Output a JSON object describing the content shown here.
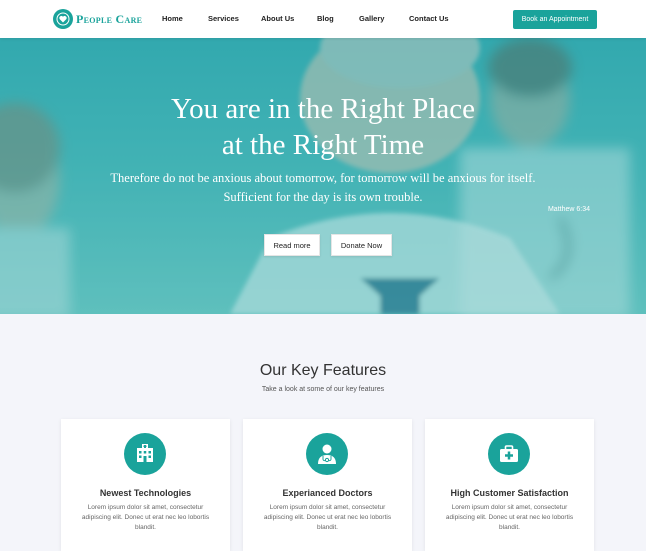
{
  "brand": {
    "name": "People Care",
    "accent": "#1aa39b"
  },
  "nav": {
    "items": [
      "Home",
      "Services",
      "About Us",
      "Blog",
      "Gallery",
      "Contact Us"
    ],
    "cta": "Book an Appointment"
  },
  "hero": {
    "title_line1": "You are in the Right Place",
    "title_line2": "at the Right Time",
    "quote_line1": "Therefore do not be anxious about tomorrow, for tomorrow will be anxious for itself.",
    "quote_line2": "Sufficient for the day is its own trouble.",
    "citation": "Matthew 6:34",
    "btn_read_more": "Read more",
    "btn_donate": "Donate Now"
  },
  "features": {
    "title": "Our Key Features",
    "subtitle": "Take a look at some of our key features",
    "cards": [
      {
        "icon": "hospital-icon",
        "title": "Newest Technologies",
        "text": "Lorem ipsum dolor sit amet, consectetur adipiscing elit. Donec ut erat nec leo lobortis blandit."
      },
      {
        "icon": "doctor-icon",
        "title": "Experianced Doctors",
        "text": "Lorem ipsum dolor sit amet, consectetur adipiscing elit. Donec ut erat nec leo lobortis blandit."
      },
      {
        "icon": "first-aid-kit-icon",
        "title": "High Customer Satisfaction",
        "text": "Lorem ipsum dolor sit amet, consectetur adipiscing elit. Donec ut erat nec leo lobortis blandit."
      }
    ]
  }
}
